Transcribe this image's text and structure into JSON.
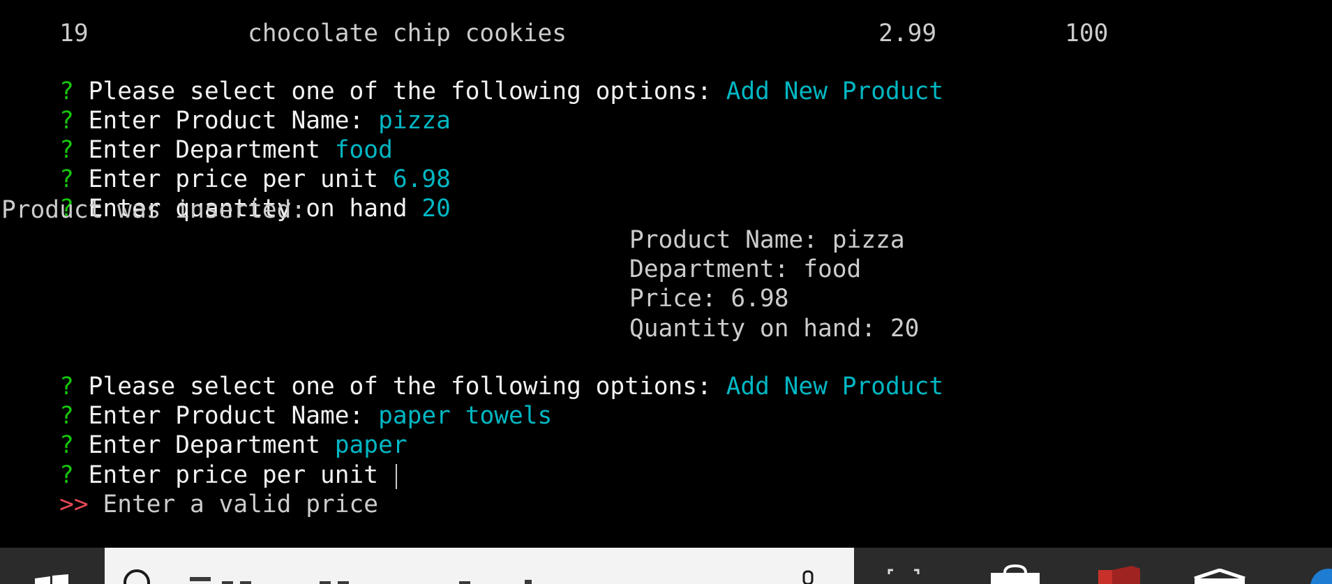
{
  "console": {
    "top_row": {
      "id": "19",
      "name": "chocolate chip cookies",
      "price": "2.99",
      "quantity": "100"
    },
    "prompt_marker": "?",
    "lines": [
      {
        "prompt": "Please select one of the following options: ",
        "answer": "Add New Product"
      },
      {
        "prompt": "Enter Product Name: ",
        "answer": "pizza"
      },
      {
        "prompt": "Enter Department ",
        "answer": "food"
      },
      {
        "prompt": "Enter price per unit ",
        "answer": "6.98"
      },
      {
        "prompt": "Enter quantity on hand ",
        "answer": "20"
      }
    ],
    "inserted_msg": "Product was inserted:",
    "details": [
      "Product Name: pizza",
      "Department: food",
      "Price: 6.98",
      "Quantity on hand: 20"
    ],
    "lines2": [
      {
        "prompt": "Please select one of the following options: ",
        "answer": "Add New Product"
      },
      {
        "prompt": "Enter Product Name: ",
        "answer": "paper towels"
      },
      {
        "prompt": "Enter Department ",
        "answer": "paper"
      },
      {
        "prompt": "Enter price per unit ",
        "answer": ""
      }
    ],
    "error_marker": ">>",
    "error_msg": "Enter a valid price"
  },
  "colors": {
    "background": "#000000",
    "prompt_marker": "#16c60c",
    "answer": "#00b7c3",
    "error_marker": "#e74856",
    "text": "#cccccc",
    "bold_text": "#f2f2f2"
  },
  "taskbar": {
    "icons": [
      "windows-start-icon",
      "search-icon",
      "microphone-icon",
      "task-view-icon",
      "store-icon",
      "office-icon",
      "mail-icon",
      "edge-icon"
    ]
  }
}
